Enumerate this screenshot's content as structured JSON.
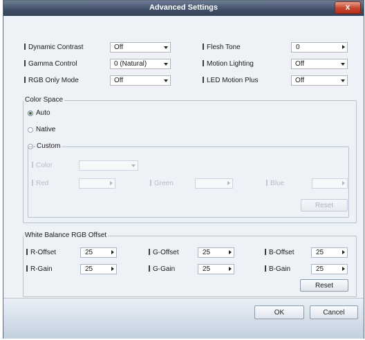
{
  "window": {
    "title": "Advanced Settings",
    "close_glyph": "x"
  },
  "picture": {
    "dynamic_contrast": {
      "label": "Dynamic Contrast",
      "value": "Off"
    },
    "gamma_control": {
      "label": "Gamma Control",
      "value": "0 (Natural)"
    },
    "rgb_only_mode": {
      "label": "RGB Only Mode",
      "value": "Off"
    },
    "flesh_tone": {
      "label": "Flesh Tone",
      "value": "0"
    },
    "motion_lighting": {
      "label": "Motion Lighting",
      "value": "Off"
    },
    "led_motion_plus": {
      "label": "LED Motion Plus",
      "value": "Off"
    }
  },
  "color_space": {
    "group_title": "Color Space",
    "options": [
      "Auto",
      "Native",
      "Custom"
    ],
    "selected": "Auto",
    "custom": {
      "color_label": "Color",
      "red_label": "Red",
      "green_label": "Green",
      "blue_label": "Blue",
      "reset_label": "Reset"
    }
  },
  "white_balance": {
    "group_title": "White Balance RGB Offset",
    "r_offset": {
      "label": "R-Offset",
      "value": "25"
    },
    "g_offset": {
      "label": "G-Offset",
      "value": "25"
    },
    "b_offset": {
      "label": "B-Offset",
      "value": "25"
    },
    "r_gain": {
      "label": "R-Gain",
      "value": "25"
    },
    "g_gain": {
      "label": "G-Gain",
      "value": "25"
    },
    "b_gain": {
      "label": "B-Gain",
      "value": "25"
    },
    "reset_label": "Reset"
  },
  "footer": {
    "ok_label": "OK",
    "cancel_label": "Cancel"
  },
  "colors": {
    "titlebar": "#3f4e66",
    "close": "#c8452b",
    "panel": "#eef1f6"
  }
}
